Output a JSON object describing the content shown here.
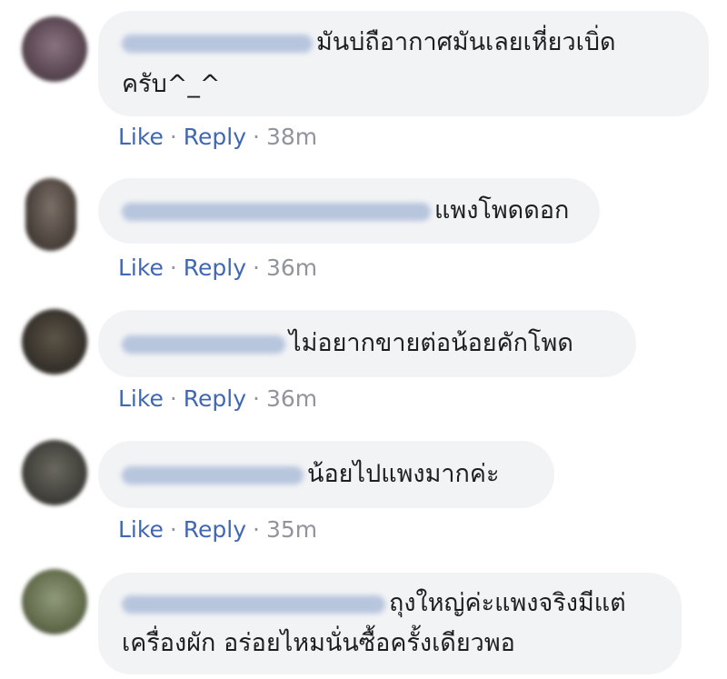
{
  "comments": [
    {
      "text": "มันบ่ถือากาศมันเลยเหี่ยวเบิ่ด",
      "text2": "ครับ^_^",
      "like": "Like",
      "reply": "Reply",
      "time": "38m",
      "avatar_color": "#6d5a63"
    },
    {
      "text": "แพงโพดดอก",
      "like": "Like",
      "reply": "Reply",
      "time": "36m",
      "avatar_color": "#5a5048"
    },
    {
      "text": "ไม่อยากขายต่อน้อยคักโพด",
      "like": "Like",
      "reply": "Reply",
      "time": "36m",
      "avatar_color": "#3f3a33"
    },
    {
      "text": "น้อยไปแพงมากค่ะ",
      "like": "Like",
      "reply": "Reply",
      "time": "35m",
      "avatar_color": "#4b4a44"
    },
    {
      "text": "ถุงใหญ่ค่ะแพงจริงมีแต่",
      "text2": "เครื่องผัก อร่อยไหมนั่นซื้อครั้งเดียวพอ",
      "avatar_color": "#6f7a5e"
    }
  ],
  "colors": {
    "link": "#4267b2",
    "muted": "#90949c",
    "bubble": "#f2f3f5"
  }
}
